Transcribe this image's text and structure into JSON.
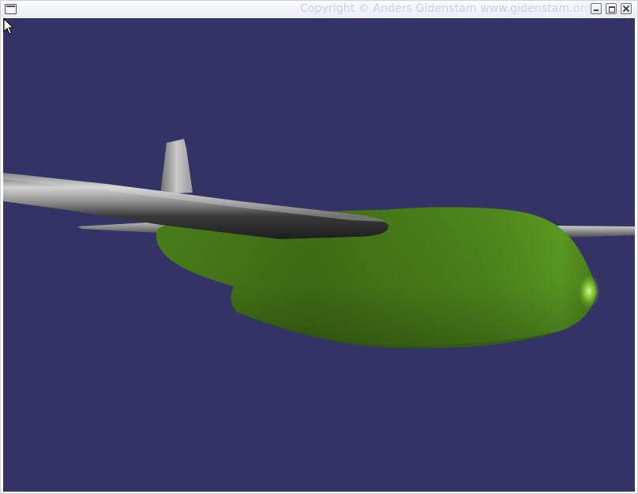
{
  "window": {
    "title": "Copyright © Anders Gidenstam  www.gidenstam.org",
    "icons": {
      "menu": "window-menu-icon",
      "minimize": "minimize-icon",
      "maximize": "maximize-icon",
      "close": "close-icon"
    }
  },
  "scene": {
    "background_color": "#333366",
    "fuselage_color": "#4e8a1e",
    "wing_color": "#8c8c8c",
    "cursor_icon": "pointer-arrow-icon"
  }
}
